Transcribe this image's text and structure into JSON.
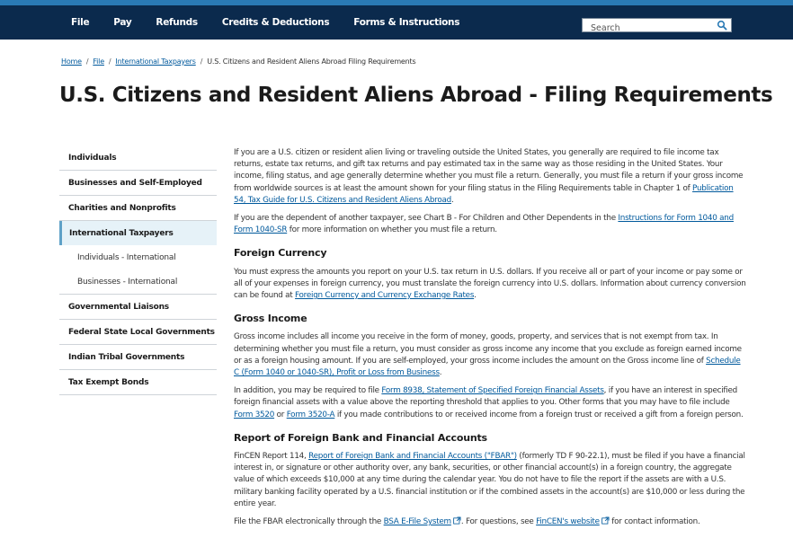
{
  "nav": {
    "items": [
      "File",
      "Pay",
      "Refunds",
      "Credits & Deductions",
      "Forms & Instructions"
    ],
    "search_placeholder": "Search"
  },
  "breadcrumb": {
    "links": [
      "Home",
      "File",
      "International Taxpayers"
    ],
    "current": "U.S. Citizens and Resident Aliens Abroad Filing Requirements"
  },
  "page_title": "U.S. Citizens and Resident Aliens Abroad - Filing Requirements",
  "sidebar": {
    "items": [
      "Individuals",
      "Businesses and Self-Employed",
      "Charities and Nonprofits",
      "International Taxpayers",
      "Individuals - International",
      "Businesses - International",
      "Governmental Liaisons",
      "Federal State Local Governments",
      "Indian Tribal Governments",
      "Tax Exempt Bonds"
    ]
  },
  "content": {
    "intro": {
      "text1": "If you are a U.S. citizen or resident alien living or traveling outside the United States, you generally are required to file income tax returns, estate tax returns, and gift tax returns and pay estimated tax in the same way as those residing in the United States. Your income, filing status, and age generally determine whether you must file a return. Generally, you must file a return if your gross income from worldwide sources is at least the amount shown for your filing status in the Filing Requirements table in Chapter 1 of ",
      "link1": "Publication 54, Tax Guide for U.S. Citizens and Resident Aliens Abroad",
      "text2": "."
    },
    "dependent": {
      "text1": "If you are the dependent of another taxpayer, see Chart B - For Children and Other Dependents in the ",
      "link1": "Instructions for Form 1040 and Form 1040-SR",
      "text2": " for more information on whether you must file a return."
    },
    "foreign_currency": {
      "heading": "Foreign Currency",
      "text1": "You must express the amounts you report on your U.S. tax return in U.S. dollars. If you receive all or part of your income or pay some or all of your expenses in foreign currency, you must translate the foreign currency into U.S. dollars. Information about currency conversion can be found at ",
      "link1": "Foreign Currency and Currency Exchange Rates",
      "text2": "."
    },
    "gross_income": {
      "heading": "Gross Income",
      "p1_text1": "Gross income includes all income you receive in the form of money, goods, property, and services that is not exempt from tax. In determining whether you must file a return, you must consider as gross income any income that you exclude as foreign earned income or as a foreign housing amount. If you are self-employed, your gross income includes the amount on the Gross income line of ",
      "p1_link1": "Schedule C (Form 1040 or 1040-SR), Profit or Loss from Business",
      "p1_text2": ".",
      "p2_text1": "In addition, you may be required to file ",
      "p2_link1": "Form 8938, Statement of Specified Foreign Financial Assets",
      "p2_text2": ", if you have an interest in specified foreign financial assets with a value above the reporting threshold that applies to you. Other forms that you may have to file include ",
      "p2_link2": "Form 3520",
      "p2_text3": " or ",
      "p2_link3": "Form 3520-A",
      "p2_text4": " if you made contributions to or received income from a foreign trust or received a gift from a foreign person."
    },
    "fbar": {
      "heading": "Report of Foreign Bank and Financial Accounts",
      "p1_text1": "FinCEN Report 114, ",
      "p1_link1": "Report of Foreign Bank and Financial Accounts (\"FBAR\")",
      "p1_text2": " (formerly TD F 90-22.1), must be filed if you have a financial interest in, or signature or other authority over, any bank, securities, or other financial account(s) in a foreign country, the aggregate value of which exceeds $10,000 at any time during the calendar year. You do not have to file the report if the assets are with a U.S. military banking facility operated by a U.S. financial institution or if the combined assets in the account(s) are $10,000 or less during the entire year.",
      "p2_text1": "File the FBAR electronically through the ",
      "p2_link1": "BSA E-File System",
      "p2_text2": ". For questions, see ",
      "p2_link2": "FinCEN's website",
      "p2_text3": " for contact information."
    }
  },
  "colors": {
    "nav_bg": "#0b2a4d",
    "stripe": "#2a7ab5",
    "link": "#00599c",
    "active_sidebar_bg": "#e6f2f8"
  },
  "icons": [
    "search-icon",
    "external-link-icon"
  ]
}
